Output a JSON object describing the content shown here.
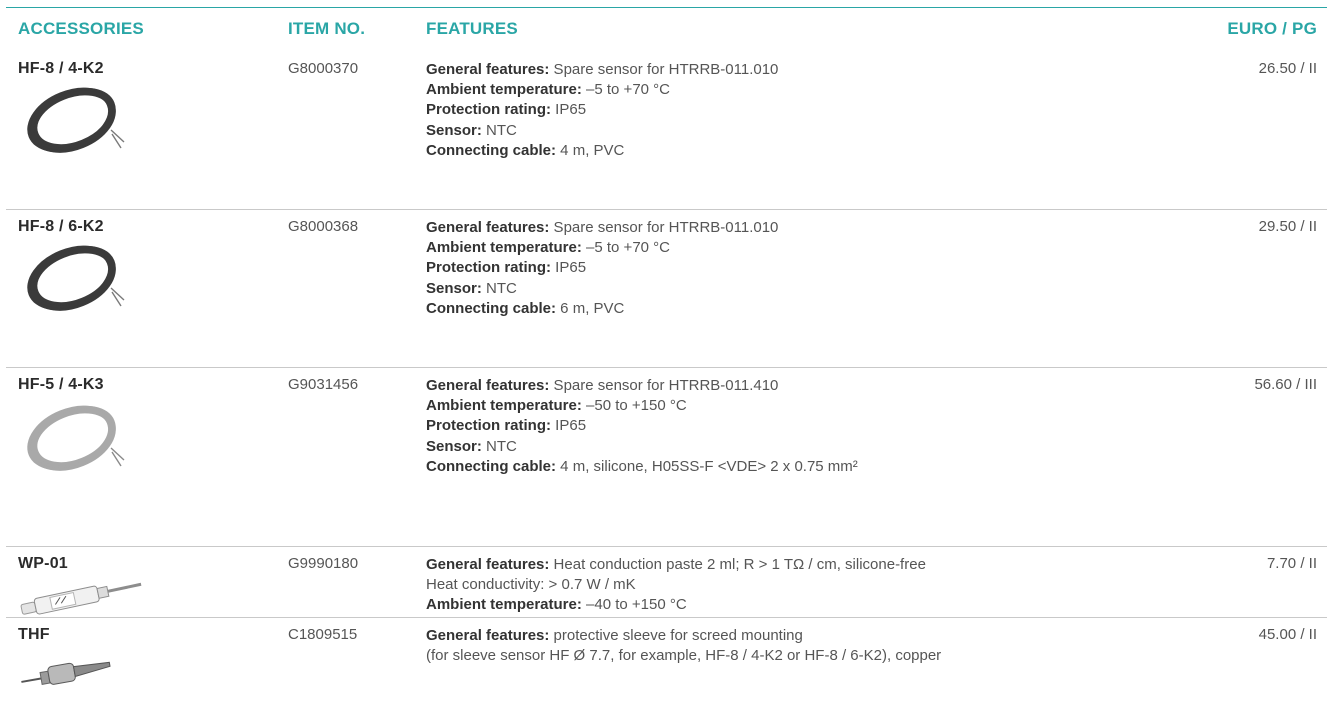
{
  "table": {
    "headers": {
      "accessories": "ACCESSORIES",
      "item_no": "ITEM NO.",
      "features": "FEATURES",
      "price": "EURO / PG"
    },
    "rows": [
      {
        "name": "HF-8 / 4-K2",
        "item_no": "G8000370",
        "image": "coiled-black-cable",
        "price": "26.50 / II",
        "features": [
          {
            "label": "General features:",
            "text": " Spare sensor for HTRRB-011.010"
          },
          {
            "label": "Ambient temperature:",
            "text": " –5 to +70 °C"
          },
          {
            "label": "Protection rating:",
            "text": " IP65"
          },
          {
            "label": "Sensor:",
            "text": " NTC"
          },
          {
            "label": "Connecting cable:",
            "text": " 4 m, PVC"
          }
        ]
      },
      {
        "name": "HF-8 / 6-K2",
        "item_no": "G8000368",
        "image": "coiled-black-cable",
        "price": "29.50 / II",
        "features": [
          {
            "label": "General features:",
            "text": " Spare sensor for HTRRB-011.010"
          },
          {
            "label": "Ambient temperature:",
            "text": " –5 to +70 °C"
          },
          {
            "label": "Protection rating:",
            "text": " IP65"
          },
          {
            "label": "Sensor:",
            "text": " NTC"
          },
          {
            "label": "Connecting cable:",
            "text": " 6 m, PVC"
          }
        ]
      },
      {
        "name": "HF-5 / 4-K3",
        "item_no": "G9031456",
        "image": "coiled-grey-cable",
        "price": "56.60 / III",
        "features": [
          {
            "label": "General features:",
            "text": " Spare sensor for HTRRB-011.410"
          },
          {
            "label": "Ambient temperature:",
            "text": " –50 to +150 °C"
          },
          {
            "label": "Protection rating:",
            "text": " IP65"
          },
          {
            "label": "Sensor:",
            "text": " NTC"
          },
          {
            "label": "Connecting cable:",
            "text": " 4 m, silicone, H05SS-F <VDE> 2 x 0.75 mm²"
          }
        ]
      },
      {
        "name": "WP-01",
        "item_no": "G9990180",
        "image": "paste-syringe",
        "price": "7.70 / II",
        "features": [
          {
            "label": "General features:",
            "text": " Heat conduction paste 2 ml; R > 1 TΩ / cm, silicone-free"
          },
          {
            "label": "",
            "text": "Heat conductivity: > 0.7 W / mK"
          },
          {
            "label": "Ambient temperature:",
            "text": " –40 to +150 °C"
          }
        ]
      },
      {
        "name": "THF",
        "item_no": "C1809515",
        "image": "copper-sleeve",
        "price": "45.00 / II",
        "features": [
          {
            "label": "General features:",
            "text": " protective sleeve for screed mounting"
          },
          {
            "label": "",
            "text": "(for sleeve sensor HF Ø 7.7, for example, HF-8 / 4-K2 or HF-8 / 6-K2), copper"
          }
        ]
      }
    ]
  },
  "colors": {
    "accent": "#2aa6a6",
    "separator": "#c9c9c9",
    "text": "#555555"
  }
}
